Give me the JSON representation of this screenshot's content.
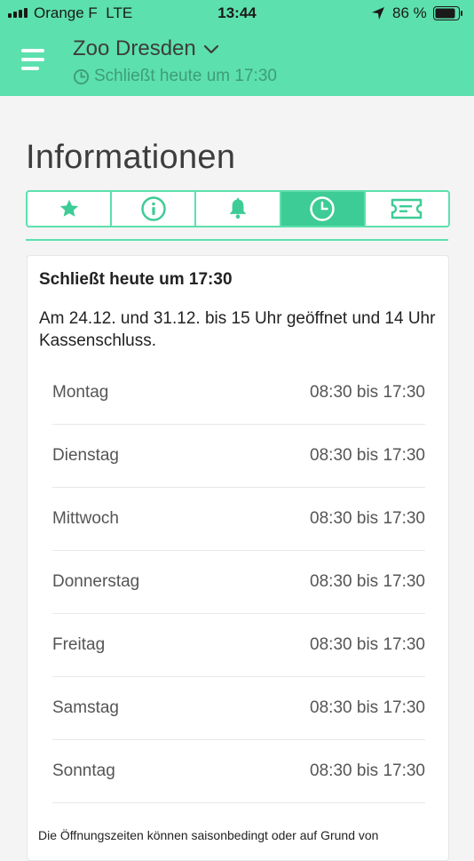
{
  "status_bar": {
    "carrier": "Orange F",
    "network": "LTE",
    "time": "13:44",
    "battery": "86 %"
  },
  "app_bar": {
    "title": "Zoo Dresden",
    "subtitle": "Schließt heute um 17:30"
  },
  "page": {
    "title": "Informationen"
  },
  "tabs": [
    {
      "icon": "star-icon",
      "active": false
    },
    {
      "icon": "info-icon",
      "active": false
    },
    {
      "icon": "bell-icon",
      "active": false
    },
    {
      "icon": "clock-icon",
      "active": true
    },
    {
      "icon": "ticket-icon",
      "active": false
    }
  ],
  "card": {
    "title": "Schließt heute um 17:30",
    "note": "Am 24.12. und 31.12. bis 15 Uhr geöffnet und 14 Uhr Kassenschluss.",
    "hours": [
      {
        "day": "Montag",
        "time": "08:30 bis 17:30"
      },
      {
        "day": "Dienstag",
        "time": "08:30 bis 17:30"
      },
      {
        "day": "Mittwoch",
        "time": "08:30 bis 17:30"
      },
      {
        "day": "Donnerstag",
        "time": "08:30 bis 17:30"
      },
      {
        "day": "Freitag",
        "time": "08:30 bis 17:30"
      },
      {
        "day": "Samstag",
        "time": "08:30 bis 17:30"
      },
      {
        "day": "Sonntag",
        "time": "08:30 bis 17:30"
      }
    ]
  },
  "footer_note": "Die Öffnungszeiten können saisonbedingt oder auf Grund von",
  "colors": {
    "accent": "#5ce0ad",
    "accent_dark": "#3dcc96",
    "subtitle": "#3e9d77"
  }
}
